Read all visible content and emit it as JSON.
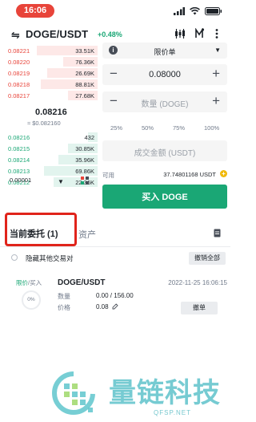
{
  "status_bar": {
    "time": "16:06"
  },
  "header": {
    "pair": "DOGE/USDT",
    "change": "+0.48%"
  },
  "order_book": {
    "asks": [
      {
        "price": "0.08221",
        "qty": "33.51K",
        "depth": 0.62
      },
      {
        "price": "0.08220",
        "qty": "76.36K",
        "depth": 0.35
      },
      {
        "price": "0.08219",
        "qty": "26.69K",
        "depth": 0.52
      },
      {
        "price": "0.08218",
        "qty": "88.81K",
        "depth": 0.58
      },
      {
        "price": "0.08217",
        "qty": "27.68K",
        "depth": 0.3
      }
    ],
    "mid_price": "0.08216",
    "mid_fiat": "≈ $0.082160",
    "bids": [
      {
        "price": "0.08216",
        "qty": "432",
        "depth": 0.1
      },
      {
        "price": "0.08215",
        "qty": "30.85K",
        "depth": 0.3
      },
      {
        "price": "0.08214",
        "qty": "35.96K",
        "depth": 0.4
      },
      {
        "price": "0.08213",
        "qty": "69.86K",
        "depth": 0.55
      },
      {
        "price": "0.08212",
        "qty": "22.36K",
        "depth": 0.45
      }
    ],
    "precision": "0.00001"
  },
  "order_form": {
    "order_type": "限价单",
    "price_value": "0.08000",
    "amount_placeholder": "数量 (DOGE)",
    "percents": [
      "25%",
      "50%",
      "75%",
      "100%"
    ],
    "total_placeholder": "成交金额 (USDT)",
    "available_label": "可用",
    "available_value": "37.74801168 USDT",
    "buy_label": "买入 DOGE"
  },
  "tabs": {
    "open_orders": "当前委托 (1)",
    "assets": "资产"
  },
  "filters": {
    "hide_other_pairs": "隐藏其他交易对",
    "cancel_all": "撤销全部"
  },
  "open_order": {
    "type": "限价",
    "side": "/买入",
    "pair": "DOGE/USDT",
    "datetime": "2022-11-25 16:06:15",
    "filled_pct": "0%",
    "amount_label": "数量",
    "amount_value": "0.00 / 156.00",
    "price_label": "价格",
    "price_value": "0.08",
    "cancel_label": "撤单"
  },
  "watermark": {
    "text": "量链科技",
    "url": "QFSP.NET"
  },
  "colors": {
    "buy": "#1aa775",
    "sell": "#e8443a",
    "accent": "#f0b90b",
    "highlight": "#e0241b"
  }
}
